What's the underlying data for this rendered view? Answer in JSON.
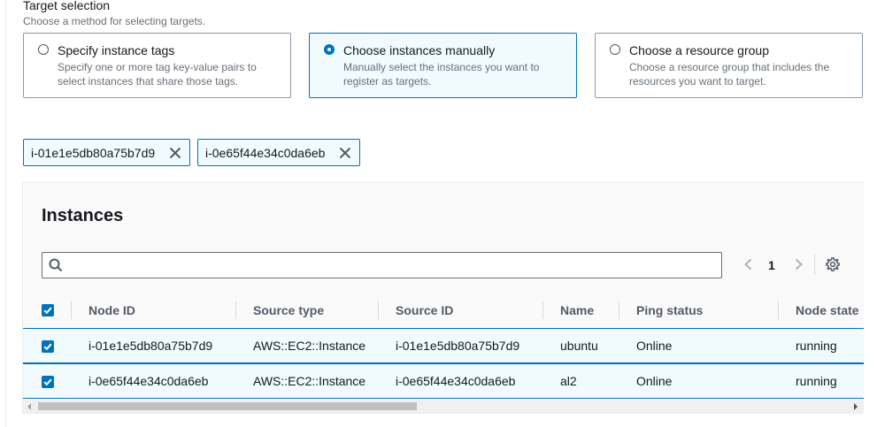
{
  "target_selection": {
    "title": "Target selection",
    "description": "Choose a method for selecting targets.",
    "options": [
      {
        "label": "Specify instance tags",
        "description": "Specify one or more tag key-value pairs to select instances that share those tags.",
        "selected": false
      },
      {
        "label": "Choose instances manually",
        "description": "Manually select the instances you want to register as targets.",
        "selected": true
      },
      {
        "label": "Choose a resource group",
        "description": "Choose a resource group that includes the resources you want to target.",
        "selected": false
      }
    ]
  },
  "selected_tokens": [
    {
      "label": "i-01e1e5db80a75b7d9",
      "icon": "close-icon"
    },
    {
      "label": "i-0e65f44e34c0da6eb",
      "icon": "close-icon"
    }
  ],
  "instances": {
    "title": "Instances",
    "search": {
      "value": "",
      "placeholder": "",
      "icon": "search-icon"
    },
    "pagination": {
      "current_page": "1"
    },
    "settings_icon": "gear-icon",
    "header_checkbox_checked": true,
    "columns": [
      "Node ID",
      "Source type",
      "Source ID",
      "Name",
      "Ping status",
      "Node state"
    ],
    "rows": [
      {
        "checked": true,
        "cells": [
          "i-01e1e5db80a75b7d9",
          "AWS::EC2::Instance",
          "i-01e1e5db80a75b7d9",
          "ubuntu",
          "Online",
          "running"
        ]
      },
      {
        "checked": true,
        "cells": [
          "i-0e65f44e34c0da6eb",
          "AWS::EC2::Instance",
          "i-0e65f44e34c0da6eb",
          "al2",
          "Online",
          "running"
        ]
      }
    ]
  },
  "colors": {
    "accent": "#0073bb",
    "selected_background": "#f1faff",
    "text": "#16191f",
    "secondary_text": "#687078"
  }
}
